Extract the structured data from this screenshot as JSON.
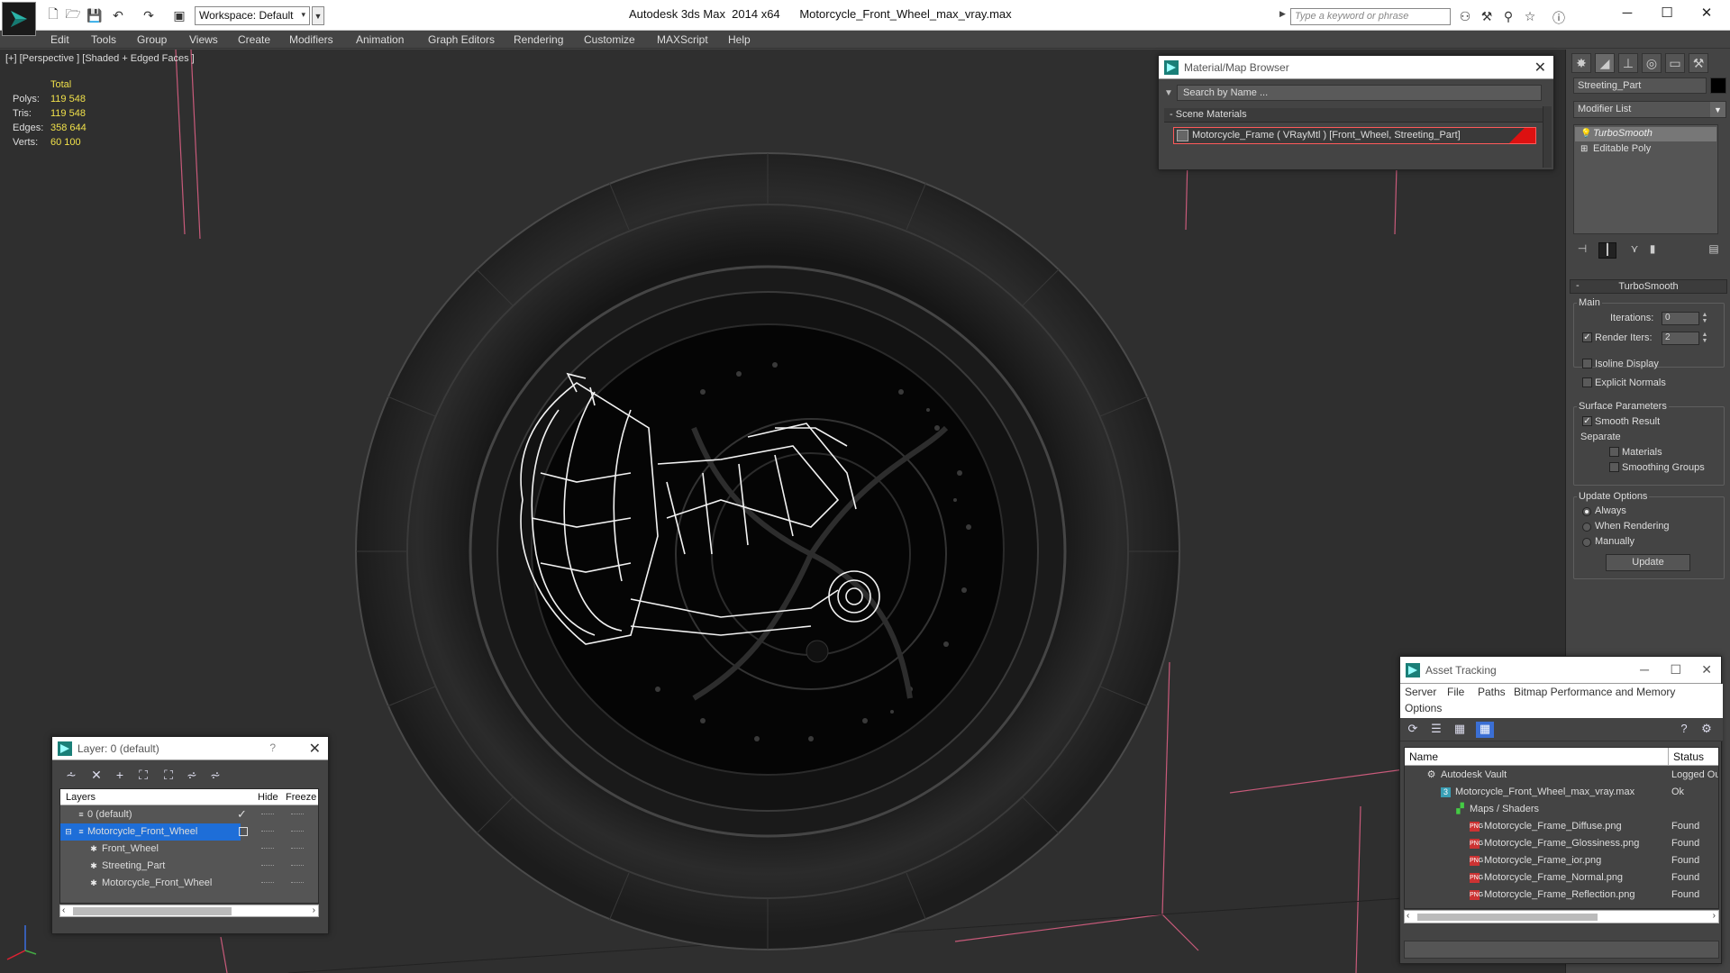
{
  "title_bar": {
    "workspace": "Workspace: Default",
    "app": "Autodesk 3ds Max  2014 x64",
    "file": "Motorcycle_Front_Wheel_max_vray.max",
    "search_placeholder": "Type a keyword or phrase"
  },
  "menu": [
    "Edit",
    "Tools",
    "Group",
    "Views",
    "Create",
    "Modifiers",
    "Animation",
    "Graph Editors",
    "Rendering",
    "Customize",
    "MAXScript",
    "Help"
  ],
  "viewport": {
    "label": "[+] [Perspective ] [Shaded + Edged Faces ]",
    "stats": {
      "header": "Total",
      "rows": [
        {
          "label": "Polys:",
          "value": "119 548"
        },
        {
          "label": "Tris:",
          "value": "119 548"
        },
        {
          "label": "Edges:",
          "value": "358 644"
        },
        {
          "label": "Verts:",
          "value": "60 100"
        }
      ]
    }
  },
  "material_browser": {
    "title": "Material/Map Browser",
    "search_placeholder": "Search by Name ...",
    "section": "Scene Materials",
    "item": "Motorcycle_Frame  ( VRayMtl )  [Front_Wheel, Streeting_Part]",
    "swatch_color": "#d11111"
  },
  "command_panel": {
    "object_name": "Streeting_Part",
    "modifier_list": "Modifier List",
    "stack": [
      "TurboSmooth",
      "Editable Poly"
    ],
    "rollout": {
      "title": "TurboSmooth",
      "main_label": "Main",
      "iterations_label": "Iterations:",
      "iterations_value": "0",
      "render_iters_label": "Render Iters:",
      "render_iters_value": "2",
      "render_iters_checked": true,
      "isoline_label": "Isoline Display",
      "isoline_checked": false,
      "explicit_label": "Explicit Normals",
      "explicit_checked": false,
      "surface_label": "Surface Parameters",
      "smooth_label": "Smooth Result",
      "smooth_checked": true,
      "separate_label": "Separate",
      "materials_label": "Materials",
      "materials_checked": false,
      "smoothing_groups_label": "Smoothing Groups",
      "smoothing_groups_checked": false,
      "update_options_label": "Update Options",
      "always_label": "Always",
      "when_rendering_label": "When Rendering",
      "manually_label": "Manually",
      "update_mode": "Always",
      "update_button": "Update"
    }
  },
  "layer_panel": {
    "title": "Layer: 0 (default)",
    "help": "?",
    "columns": {
      "layers": "Layers",
      "hide": "Hide",
      "freeze": "Freeze"
    },
    "rows": [
      {
        "name": "0 (default)",
        "indent": 0
      },
      {
        "name": "Motorcycle_Front_Wheel",
        "indent": 0
      },
      {
        "name": "Front_Wheel",
        "indent": 1
      },
      {
        "name": "Streeting_Part",
        "indent": 1
      },
      {
        "name": "Motorcycle_Front_Wheel",
        "indent": 1
      }
    ]
  },
  "asset_tracking": {
    "title": "Asset Tracking",
    "menu": [
      "Server",
      "File",
      "Paths",
      "Bitmap Performance and Memory",
      "Options"
    ],
    "columns": {
      "name": "Name",
      "status": "Status"
    },
    "rows": [
      {
        "name": "Autodesk Vault",
        "status": "Logged Out",
        "indent": 1,
        "icon": "vault-icon"
      },
      {
        "name": "Motorcycle_Front_Wheel_max_vray.max",
        "status": "Ok",
        "indent": 2,
        "icon": "max-file-icon"
      },
      {
        "name": "Maps / Shaders",
        "status": "",
        "indent": 3,
        "icon": "maps-icon"
      },
      {
        "name": "Motorcycle_Frame_Diffuse.png",
        "status": "Found",
        "indent": 4,
        "icon": "png-icon"
      },
      {
        "name": "Motorcycle_Frame_Glossiness.png",
        "status": "Found",
        "indent": 4,
        "icon": "png-icon"
      },
      {
        "name": "Motorcycle_Frame_ior.png",
        "status": "Found",
        "indent": 4,
        "icon": "png-icon"
      },
      {
        "name": "Motorcycle_Frame_Normal.png",
        "status": "Found",
        "indent": 4,
        "icon": "png-icon"
      },
      {
        "name": "Motorcycle_Frame_Reflection.png",
        "status": "Found",
        "indent": 4,
        "icon": "png-icon"
      }
    ]
  }
}
